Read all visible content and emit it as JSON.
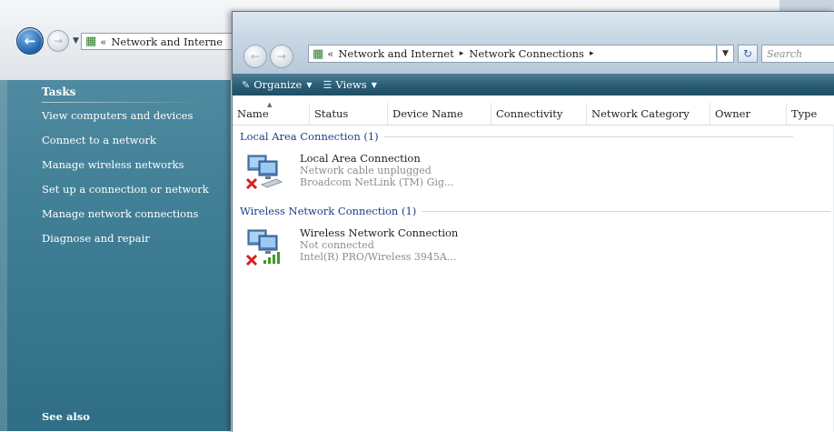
{
  "back_window": {
    "address_chevron": "«",
    "address_text": "Network and Interne",
    "tasks": {
      "title": "Tasks",
      "items": [
        "View computers and devices",
        "Connect to a network",
        "Manage wireless networks",
        "Set up a connection or network",
        "Manage network connections",
        "Diagnose and repair"
      ]
    },
    "see_also": "See also"
  },
  "front_window": {
    "address": {
      "chevron": "«",
      "segments": [
        "Network and Internet",
        "Network Connections"
      ],
      "separator": "▸"
    },
    "search_placeholder": "Search",
    "commands": {
      "organize": "Organize",
      "views": "Views"
    },
    "columns": [
      "Name",
      "Status",
      "Device Name",
      "Connectivity",
      "Network Category",
      "Owner",
      "Type"
    ],
    "groups": [
      {
        "header": "Local Area Connection (1)",
        "item": {
          "name": "Local Area Connection",
          "status": "Network cable unplugged",
          "device": "Broadcom NetLink (TM) Gig..."
        }
      },
      {
        "header": "Wireless Network Connection (1)",
        "item": {
          "name": "Wireless Network Connection",
          "status": "Not connected",
          "device": "Intel(R) PRO/Wireless 3945A..."
        }
      }
    ]
  },
  "colors": {
    "task_pane": "#3f7e95",
    "command_bar": "#2c5f78",
    "group_header": "#1a3f8c",
    "error_x": "#d42020"
  }
}
